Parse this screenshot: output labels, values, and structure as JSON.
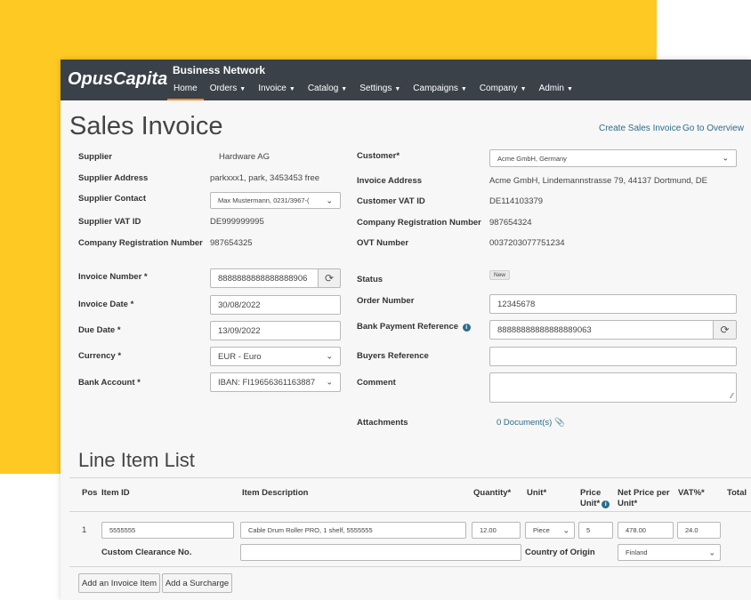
{
  "brand": {
    "logo": "OpusCapita",
    "product": "Business Network"
  },
  "nav": [
    {
      "label": "Home",
      "caret": ""
    },
    {
      "label": "Orders",
      "caret": "▼"
    },
    {
      "label": "Invoice",
      "caret": "▼"
    },
    {
      "label": "Catalog",
      "caret": "▼"
    },
    {
      "label": "Settings",
      "caret": "▼"
    },
    {
      "label": "Campaigns",
      "caret": "▼"
    },
    {
      "label": "Company",
      "caret": "▼"
    },
    {
      "label": "Admin",
      "caret": "▼"
    }
  ],
  "page": {
    "title": "Sales Invoice",
    "create_link": "Create Sales Invoice",
    "overview_link": "Go to Overview"
  },
  "supplier": {
    "supplier_label": "Supplier",
    "supplier_value": "Hardware AG",
    "address_label": "Supplier Address",
    "address_value": "parkxxx1, park, 3453453 free",
    "contact_label": "Supplier Contact",
    "contact_value": "Max Mustermann, 0231/3967-(",
    "vat_label": "Supplier VAT ID",
    "vat_value": "DE999999995",
    "reg_label": "Company Registration Number",
    "reg_value": "987654325"
  },
  "customer": {
    "customer_label": "Customer*",
    "customer_value": "Acme GmbH, Germany",
    "address_label": "Invoice Address",
    "address_value": "Acme GmbH, Lindemannstrasse 79, 44137 Dortmund, DE",
    "vat_label": "Customer VAT ID",
    "vat_value": "DE114103379",
    "reg_label": "Company Registration Number",
    "reg_value": "987654324",
    "ovt_label": "OVT Number",
    "ovt_value": "0037203077751234"
  },
  "invoice": {
    "number_label": "Invoice Number *",
    "number_value": "8888888888888888906",
    "date_label": "Invoice Date *",
    "date_value": "30/08/2022",
    "due_label": "Due Date *",
    "due_value": "13/09/2022",
    "currency_label": "Currency *",
    "currency_value": "EUR - Euro",
    "bank_label": "Bank Account *",
    "bank_value": "IBAN: FI19656361163887"
  },
  "details": {
    "status_label": "Status",
    "status_value": "New",
    "order_label": "Order Number",
    "order_value": "12345678",
    "bank_ref_label": "Bank Payment Reference",
    "bank_ref_value": "88888888888888889063",
    "buyers_label": "Buyers Reference",
    "buyers_value": "",
    "comment_label": "Comment",
    "comment_value": "",
    "attach_label": "Attachments",
    "attach_value": "0 Document(s)"
  },
  "line_items": {
    "title": "Line Item List",
    "headers": {
      "pos": "Pos",
      "item_id": "Item ID",
      "desc": "Item Description",
      "qty": "Quantity*",
      "unit": "Unit*",
      "price_unit_1": "Price",
      "price_unit_2": "Unit*",
      "net_1": "Net Price per",
      "net_2": "Unit*",
      "vat": "VAT%*",
      "total": "Total"
    },
    "rows": [
      {
        "pos": "1",
        "item_id": "5555555",
        "desc": "Cable Drum Roller PRO, 1 shelf, 5555555",
        "qty": "12.00",
        "unit": "Piece",
        "price_unit": "5",
        "net": "478.00",
        "vat": "24.0"
      }
    ],
    "clearance_label": "Custom Clearance No.",
    "clearance_value": "",
    "origin_label": "Country of Origin",
    "origin_value": "Finland",
    "add_item_button": "Add an Invoice Item",
    "add_surcharge_button": "Add a Surcharge"
  },
  "colors": {
    "accent_yellow": "#fec923",
    "topbar": "#3a4149",
    "active_underline": "#ef8c1f",
    "link": "#2b6c8c"
  },
  "icons": {
    "select": "chevron-down-icon",
    "refresh": "refresh-icon",
    "info": "info-icon",
    "attachment": "paperclip-icon"
  }
}
